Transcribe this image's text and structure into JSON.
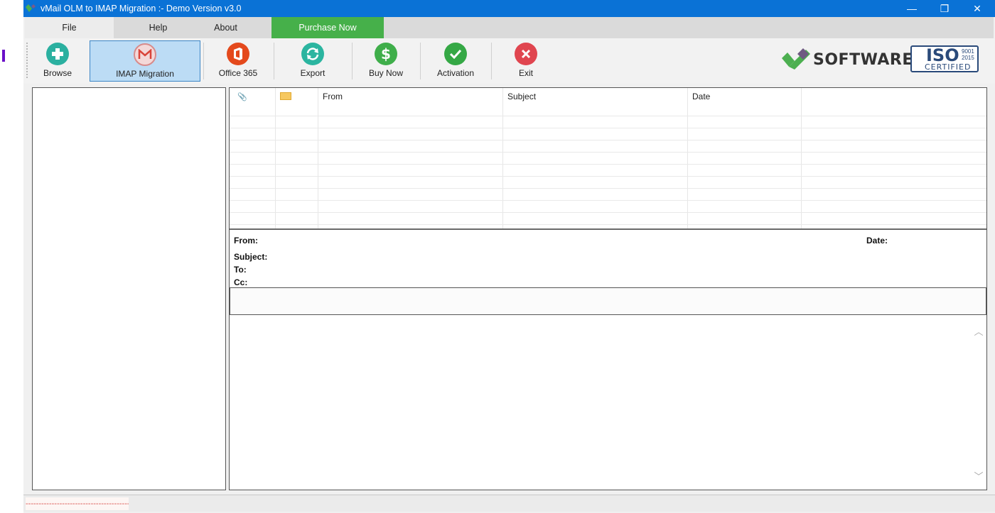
{
  "window": {
    "title": "vMail OLM to IMAP Migration :- Demo Version v3.0",
    "controls": {
      "minimize": "—",
      "restore": "❐",
      "close": "✕"
    }
  },
  "menu": {
    "items": [
      {
        "label": "File"
      },
      {
        "label": "Help"
      },
      {
        "label": "About"
      },
      {
        "label": "Purchase Now"
      }
    ],
    "purchase_color": "#46b04a"
  },
  "toolbar": {
    "buttons": [
      {
        "label": "Browse",
        "icon": "plus-icon",
        "color": "#2bb0a0"
      },
      {
        "label": "IMAP Migration",
        "icon": "gmail-icon",
        "color": "#e05a4e",
        "active": true
      },
      {
        "label": "Office 365",
        "icon": "office-icon",
        "color": "#e4491c"
      },
      {
        "label": "Export",
        "icon": "refresh-icon",
        "color": "#2bb5a0"
      },
      {
        "label": "Buy Now",
        "icon": "dollar-icon",
        "color": "#3fae4a"
      },
      {
        "label": "Activation",
        "icon": "check-icon",
        "color": "#35a845"
      },
      {
        "label": "Exit",
        "icon": "close-icon",
        "color": "#e0454f"
      }
    ]
  },
  "branding": {
    "software_text": "SOFTWARE",
    "iso_text": "ISO",
    "iso_numbers": [
      "9001",
      "2015"
    ],
    "certified_text": "CERTIFIED"
  },
  "email_grid": {
    "columns": [
      {
        "label": "",
        "icon": "attachment-icon"
      },
      {
        "label": "",
        "icon": "envelope-icon"
      },
      {
        "label": "From"
      },
      {
        "label": "Subject"
      },
      {
        "label": "Date"
      },
      {
        "label": ""
      }
    ],
    "rows": []
  },
  "preview": {
    "from_label": "From:",
    "date_label": "Date:",
    "subject_label": "Subject:",
    "to_label": "To:",
    "cc_label": "Cc:"
  },
  "status": {
    "text": "------------------------------------------"
  }
}
